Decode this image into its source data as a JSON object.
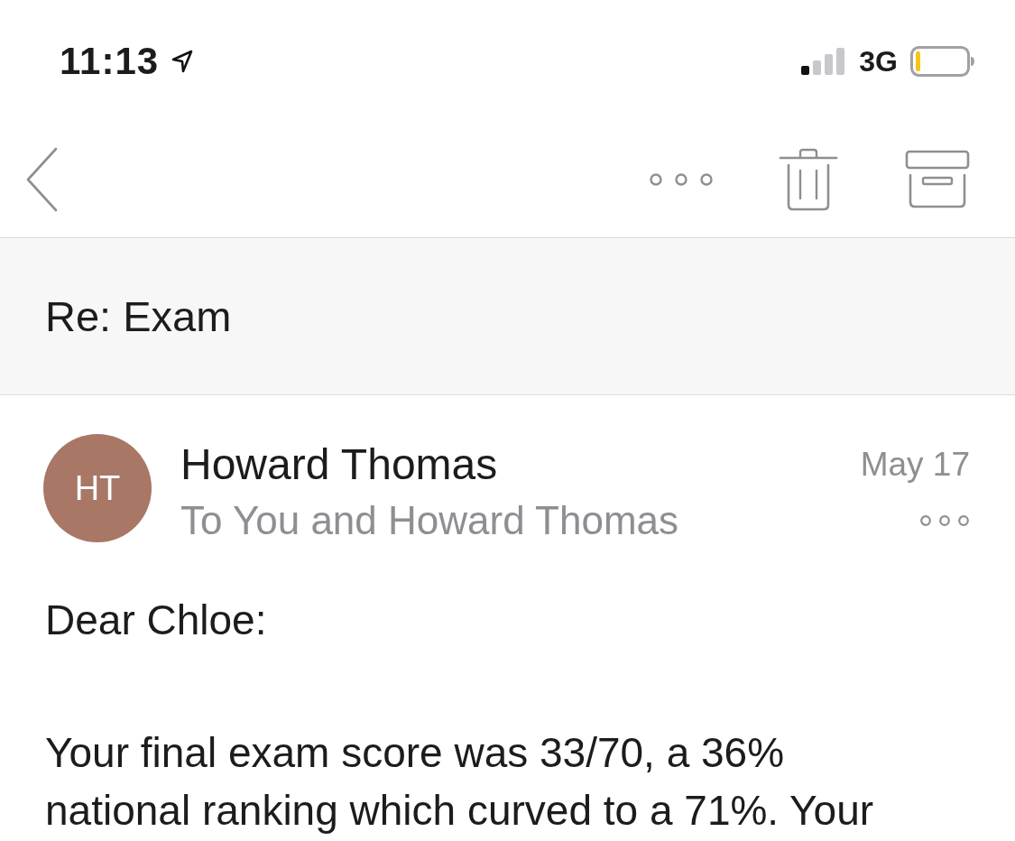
{
  "status_bar": {
    "time": "11:13",
    "network": "3G"
  },
  "subject": "Re: Exam",
  "message": {
    "avatar_initials": "HT",
    "sender": "Howard Thomas",
    "recipients": "To You and Howard Thomas",
    "date": "May 17",
    "body": [
      "Dear Chloe:",
      "Your final exam score was 33/70, a 36% national ranking which curved to a 71%. Your"
    ]
  }
}
